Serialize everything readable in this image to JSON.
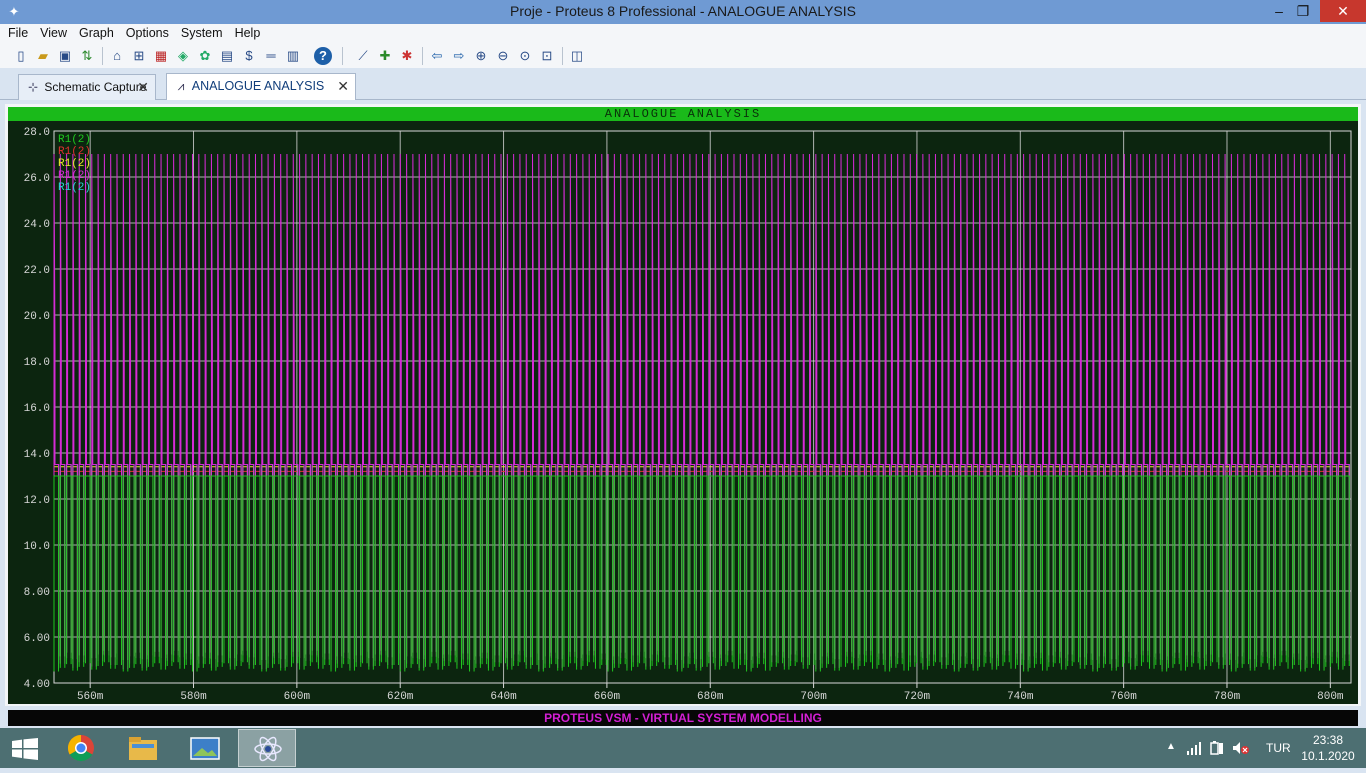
{
  "window": {
    "title": "Proje - Proteus 8 Professional - ANALOGUE ANALYSIS",
    "minimize": "–",
    "restore": "❐",
    "close": "✕"
  },
  "menu": [
    "File",
    "View",
    "Graph",
    "Options",
    "System",
    "Help"
  ],
  "toolbar_icons": [
    "new-file-icon",
    "open-file-icon",
    "save-icon",
    "import-icon",
    "home-icon",
    "schematic-icon",
    "pcb-icon",
    "3d-icon",
    "gerber-icon",
    "bom-icon",
    "design-explorer-icon",
    "notes-icon",
    "help-icon",
    "edit-graph-icon",
    "add-trace-icon",
    "simulate-graph-icon",
    "pan-left-icon",
    "pan-right-icon",
    "zoom-in-icon",
    "zoom-out-icon",
    "zoom-all-icon",
    "zoom-area-icon",
    "graph-log-icon"
  ],
  "tabs": [
    {
      "label": "Schematic Capture",
      "active": false
    },
    {
      "label": "ANALOGUE ANALYSIS",
      "active": true
    }
  ],
  "graph": {
    "title": "ANALOGUE ANALYSIS",
    "status": "PROTEUS VSM - VIRTUAL SYSTEM MODELLING",
    "colors": {
      "background": "#0c250f",
      "grid": "#d8d8d8",
      "axis_text": "#d8d8d8"
    }
  },
  "chart_data": {
    "type": "line",
    "title": "ANALOGUE ANALYSIS",
    "xlabel": "",
    "ylabel": "",
    "xlim": [
      553,
      804
    ],
    "ylim": [
      4,
      28
    ],
    "xticks": [
      "560m",
      "580m",
      "600m",
      "620m",
      "640m",
      "660m",
      "680m",
      "700m",
      "720m",
      "740m",
      "760m",
      "780m",
      "800m"
    ],
    "yticks": [
      "4.00",
      "6.00",
      "8.00",
      "10.0",
      "12.0",
      "14.0",
      "16.0",
      "18.0",
      "20.0",
      "22.0",
      "24.0",
      "26.0",
      "28.0"
    ],
    "grid": true,
    "legend": "top-left",
    "series": [
      {
        "name": "R1(2)",
        "color": "#1ec81e",
        "waveform": "pulse",
        "cycles": 206,
        "low": 4.5,
        "high": 13.0
      },
      {
        "name": "R1(2)",
        "color": "#e03030",
        "waveform": "pulse",
        "cycles": 206,
        "low": 5.0,
        "high": 13.2
      },
      {
        "name": "R1(2)",
        "color": "#e8e82c",
        "waveform": "pulse",
        "cycles": 206,
        "low": 5.0,
        "high": 13.4
      },
      {
        "name": "R1(2)",
        "color": "#d62ad6",
        "waveform": "pulse",
        "cycles": 206,
        "low": 4.6,
        "high": 27.0,
        "plateau_upper": 18.5,
        "plateau_lower": 13.5
      },
      {
        "name": "R1(2)",
        "color": "#2ad0d6",
        "waveform": "pulse",
        "cycles": 206,
        "low": 5.0,
        "high": 13.5
      }
    ]
  },
  "taskbar": {
    "apps": [
      {
        "name": "chrome-icon"
      },
      {
        "name": "file-explorer-icon"
      },
      {
        "name": "photos-icon"
      },
      {
        "name": "proteus-icon",
        "active": true
      }
    ],
    "tray": {
      "language": "TUR",
      "time": "23:38",
      "date": "10.1.2020"
    }
  }
}
